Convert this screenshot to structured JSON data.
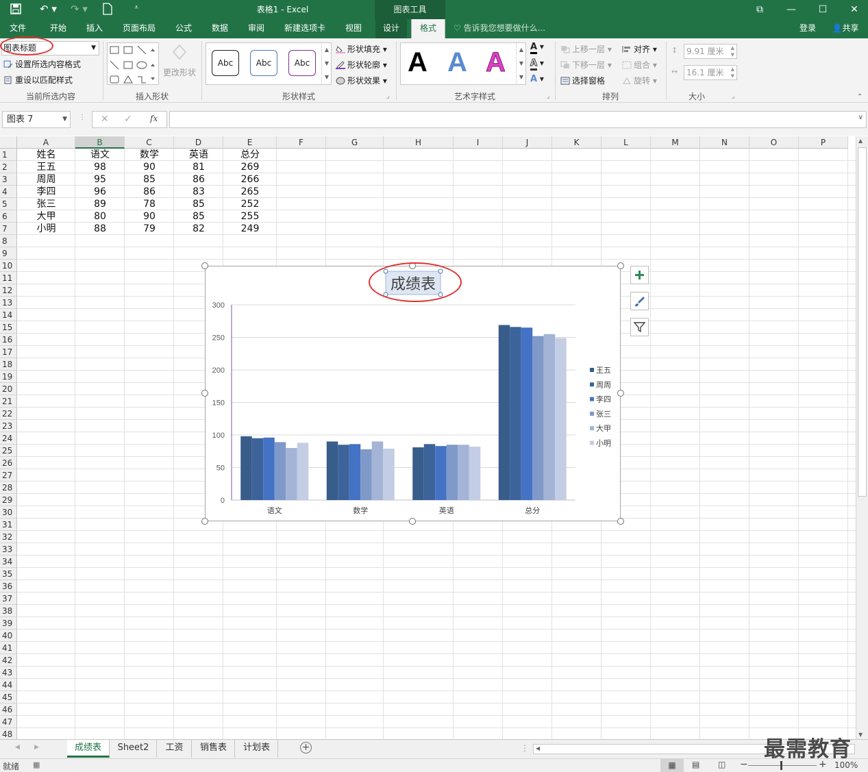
{
  "app": {
    "title": "表格1 - Excel",
    "context_tab": "图表工具"
  },
  "menu_tabs": [
    "文件",
    "开始",
    "插入",
    "页面布局",
    "公式",
    "数据",
    "审阅",
    "新建选项卡",
    "视图",
    "设计",
    "格式"
  ],
  "tell_me": "告诉我您想要做什么...",
  "account": {
    "login": "登录",
    "share": "共享"
  },
  "ribbon": {
    "selection_dropdown": "图表标题",
    "format_selection": "设置所选内容格式",
    "reset_style": "重设以匹配样式",
    "group_current": "当前所选内容",
    "change_shape": "更改形状",
    "group_insert_shapes": "插入形状",
    "style_abc": "Abc",
    "shape_fill": "形状填充",
    "shape_outline": "形状轮廓",
    "shape_effects": "形状效果",
    "group_shape_styles": "形状样式",
    "wordart_letter": "A",
    "group_wordart": "艺术字样式",
    "bring_forward": "上移一层",
    "send_backward": "下移一层",
    "selection_pane": "选择窗格",
    "align": "对齐",
    "group_objects": "组合",
    "rotate": "旋转",
    "group_arrange": "排列",
    "height": "9.91 厘米",
    "width": "16.1 厘米",
    "group_size": "大小"
  },
  "formula_bar": {
    "name_box": "图表 7",
    "fx": "fx",
    "content": ""
  },
  "columns": [
    "A",
    "B",
    "C",
    "D",
    "E",
    "F",
    "G",
    "H",
    "I",
    "J",
    "K",
    "L",
    "M",
    "N",
    "O",
    "P"
  ],
  "rows_count": 48,
  "sheet": {
    "header": [
      "姓名",
      "语文",
      "数学",
      "英语",
      "总分"
    ],
    "rows": [
      [
        "王五",
        "98",
        "90",
        "81",
        "269"
      ],
      [
        "周周",
        "95",
        "85",
        "86",
        "266"
      ],
      [
        "李四",
        "96",
        "86",
        "83",
        "265"
      ],
      [
        "张三",
        "89",
        "78",
        "85",
        "252"
      ],
      [
        "大甲",
        "80",
        "90",
        "85",
        "255"
      ],
      [
        "小明",
        "88",
        "79",
        "82",
        "249"
      ]
    ]
  },
  "chart_data": {
    "type": "bar",
    "title": "成绩表",
    "categories": [
      "语文",
      "数学",
      "英语",
      "总分"
    ],
    "series": [
      {
        "name": "王五",
        "values": [
          98,
          90,
          81,
          269
        ],
        "color": "#385d8a"
      },
      {
        "name": "周周",
        "values": [
          95,
          85,
          86,
          266
        ],
        "color": "#3c639a"
      },
      {
        "name": "李四",
        "values": [
          96,
          86,
          83,
          265
        ],
        "color": "#4472c4"
      },
      {
        "name": "张三",
        "values": [
          89,
          78,
          85,
          252
        ],
        "color": "#7f99c9"
      },
      {
        "name": "大甲",
        "values": [
          80,
          90,
          85,
          255
        ],
        "color": "#a3b4d7"
      },
      {
        "name": "小明",
        "values": [
          88,
          79,
          82,
          249
        ],
        "color": "#c3cde4"
      }
    ],
    "ylim": [
      0,
      300
    ],
    "yticks": [
      0,
      50,
      100,
      150,
      200,
      250,
      300
    ],
    "legend": "right",
    "grid": true
  },
  "sheet_tabs": [
    "成绩表",
    "Sheet2",
    "工资",
    "销售表",
    "计划表"
  ],
  "status": {
    "ready": "就绪",
    "zoom": "100%"
  },
  "watermark": "最需教育"
}
